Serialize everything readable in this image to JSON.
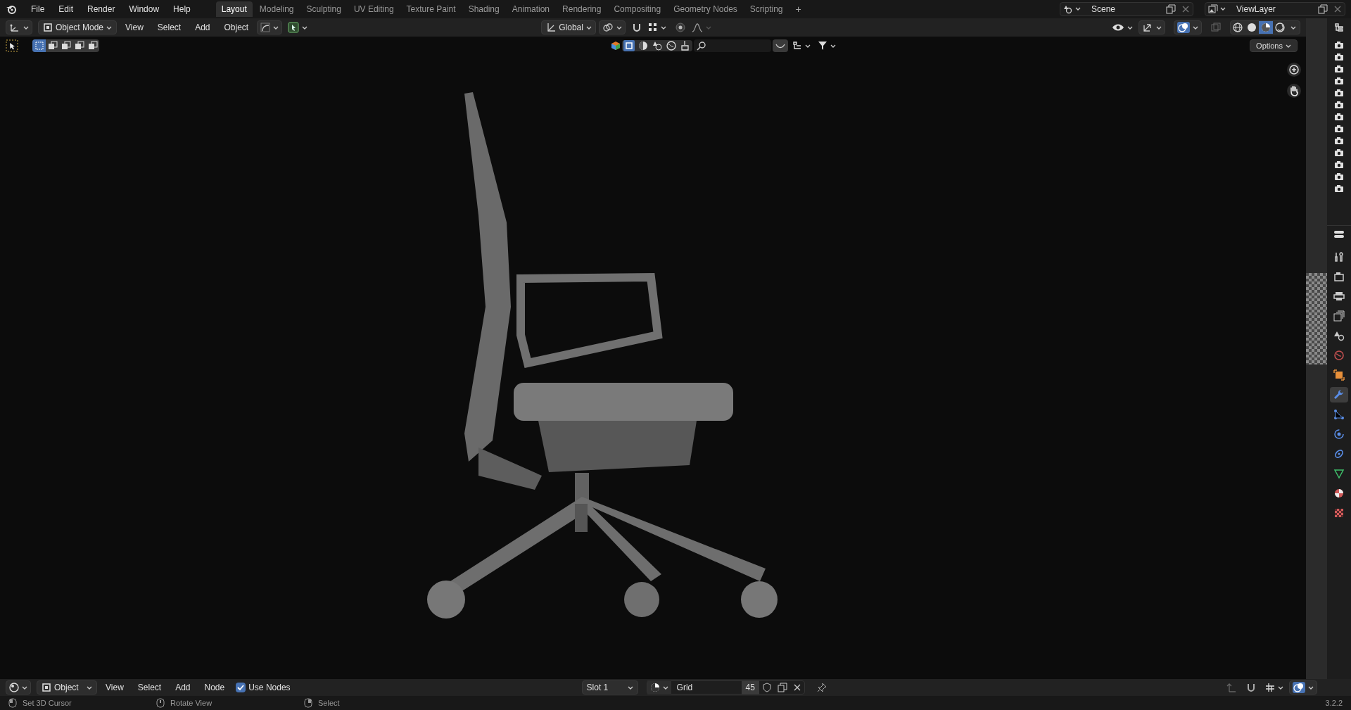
{
  "top_bar": {
    "menus": [
      "File",
      "Edit",
      "Render",
      "Window",
      "Help"
    ],
    "workspaces": [
      {
        "label": "Layout",
        "selected": true
      },
      {
        "label": "Modeling",
        "selected": false
      },
      {
        "label": "Sculpting",
        "selected": false
      },
      {
        "label": "UV Editing",
        "selected": false
      },
      {
        "label": "Texture Paint",
        "selected": false
      },
      {
        "label": "Shading",
        "selected": false
      },
      {
        "label": "Animation",
        "selected": false
      },
      {
        "label": "Rendering",
        "selected": false
      },
      {
        "label": "Compositing",
        "selected": false
      },
      {
        "label": "Geometry Nodes",
        "selected": false
      },
      {
        "label": "Scripting",
        "selected": false
      }
    ],
    "add_workspace": "+",
    "scene": "Scene",
    "view_layer": "ViewLayer"
  },
  "viewport_header": {
    "mode": "Object Mode",
    "menus": [
      "View",
      "Select",
      "Add",
      "Object"
    ],
    "orientation": "Global",
    "shading_modes": [
      {
        "kind": "wireframe",
        "selected": false
      },
      {
        "kind": "solid",
        "selected": false
      },
      {
        "kind": "material",
        "selected": true
      },
      {
        "kind": "rendered",
        "selected": false
      }
    ]
  },
  "tool_header": {
    "select_modes": [
      {
        "selected": true
      },
      {
        "selected": false
      },
      {
        "selected": false
      },
      {
        "selected": false
      },
      {
        "selected": false
      }
    ],
    "options": "Options"
  },
  "outliner": {
    "rows": [
      {
        "kind": "camera"
      },
      {
        "kind": "camera"
      },
      {
        "kind": "camera"
      },
      {
        "kind": "camera"
      },
      {
        "kind": "camera"
      },
      {
        "kind": "camera"
      },
      {
        "kind": "camera"
      },
      {
        "kind": "camera"
      },
      {
        "kind": "camera"
      },
      {
        "kind": "camera"
      },
      {
        "kind": "camera"
      },
      {
        "kind": "camera"
      },
      {
        "kind": "camera"
      }
    ]
  },
  "properties_tabs": [
    {
      "kind": "tool",
      "selected": false
    },
    {
      "kind": "render",
      "selected": false
    },
    {
      "kind": "output",
      "selected": false
    },
    {
      "kind": "view_layer",
      "selected": false
    },
    {
      "kind": "scene",
      "selected": false
    },
    {
      "kind": "world",
      "selected": false
    },
    {
      "kind": "object",
      "selected": false
    },
    {
      "kind": "modifier",
      "selected": true
    },
    {
      "kind": "particles",
      "selected": false
    },
    {
      "kind": "physics",
      "selected": false
    },
    {
      "kind": "constraints",
      "selected": false
    },
    {
      "kind": "data",
      "selected": false
    },
    {
      "kind": "material",
      "selected": false
    },
    {
      "kind": "texture",
      "selected": false
    }
  ],
  "shader_header": {
    "editor": "Object",
    "menus": [
      "View",
      "Select",
      "Add",
      "Node"
    ],
    "use_nodes": {
      "label": "Use Nodes",
      "checked": true
    },
    "slot": "Slot 1",
    "material": "Grid",
    "users": "45"
  },
  "status_bar": {
    "hints": [
      "Set 3D Cursor",
      "Rotate View",
      "Select"
    ],
    "version": "3.2.2"
  }
}
